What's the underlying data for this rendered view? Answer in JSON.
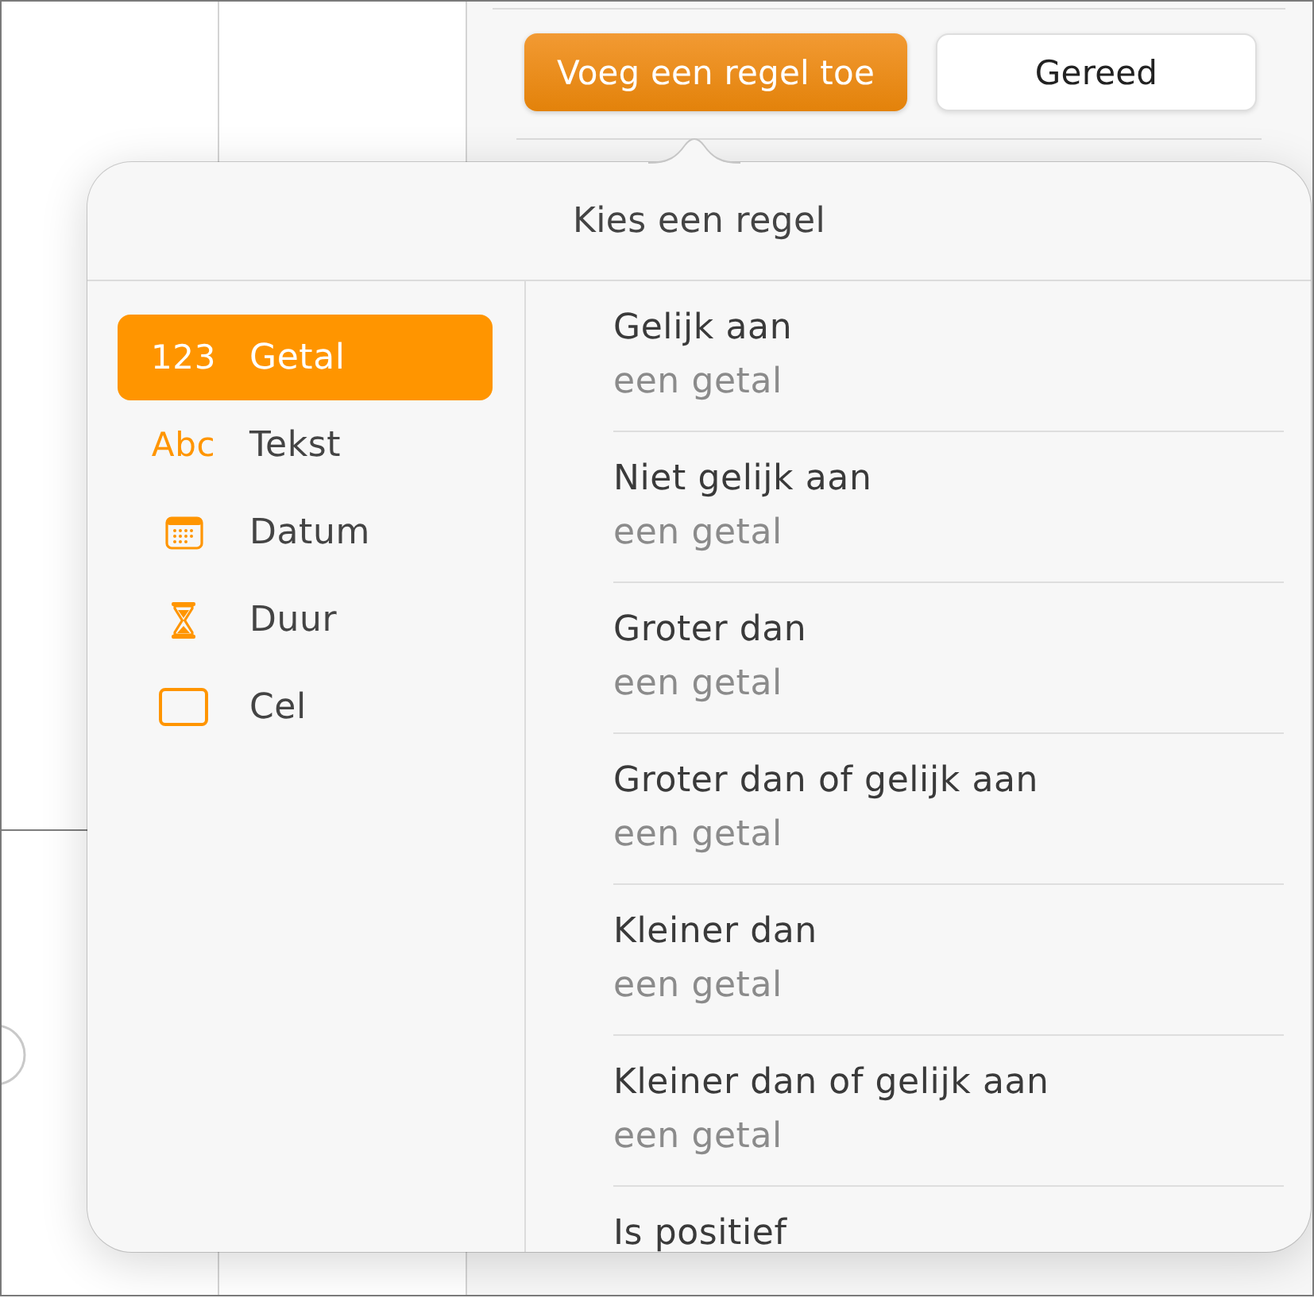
{
  "toolbar": {
    "buttons": [
      {
        "label": "Voeg een regel toe",
        "kind": "primary"
      },
      {
        "label": "Gereed",
        "kind": "secondary"
      }
    ]
  },
  "popover": {
    "title": "Kies een regel",
    "categories": [
      {
        "label": "Getal",
        "kind": "glyph",
        "glyph": "123",
        "selected": true
      },
      {
        "label": "Tekst",
        "kind": "glyph",
        "glyph": "Abc",
        "selected": false
      },
      {
        "label": "Datum",
        "kind": "calendar",
        "selected": false
      },
      {
        "label": "Duur",
        "kind": "hourglass",
        "selected": false
      },
      {
        "label": "Cel",
        "kind": "cell",
        "selected": false
      }
    ],
    "rules": [
      {
        "title": "Gelijk aan",
        "subtitle": "een getal"
      },
      {
        "title": "Niet gelijk aan",
        "subtitle": "een getal"
      },
      {
        "title": "Groter dan",
        "subtitle": "een getal"
      },
      {
        "title": "Groter dan of gelijk aan",
        "subtitle": "een getal"
      },
      {
        "title": "Kleiner dan",
        "subtitle": "een getal"
      },
      {
        "title": "Kleiner dan of gelijk aan",
        "subtitle": "een getal"
      },
      {
        "title": "Is positief"
      }
    ]
  }
}
